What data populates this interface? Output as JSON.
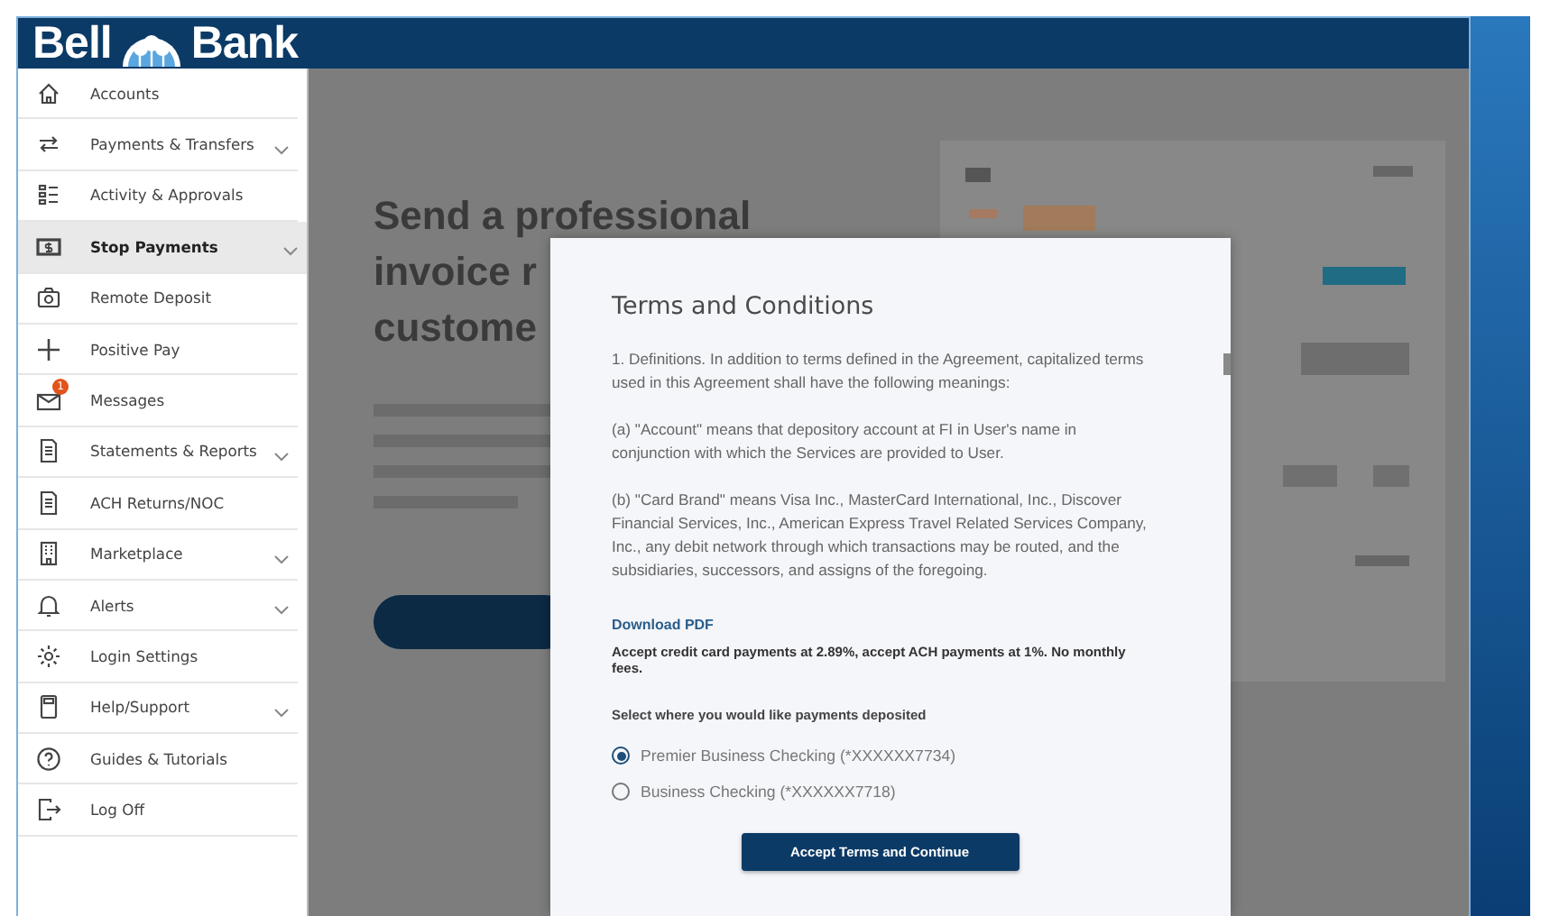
{
  "header": {
    "logo_left": "Bell",
    "logo_right": "Bank"
  },
  "sidebar": {
    "items": [
      {
        "label": "Accounts",
        "selected": false,
        "has_submenu": false
      },
      {
        "label": "Payments & Transfers",
        "selected": false,
        "has_submenu": true
      },
      {
        "label": "Activity & Approvals",
        "selected": false,
        "has_submenu": false
      },
      {
        "label": "Stop Payments",
        "selected": true,
        "has_submenu": true
      },
      {
        "label": "Remote Deposit",
        "selected": false,
        "has_submenu": false
      },
      {
        "label": "Positive Pay",
        "selected": false,
        "has_submenu": false
      },
      {
        "label": "Messages",
        "selected": false,
        "has_submenu": false,
        "badge": "1"
      },
      {
        "label": "Statements & Reports",
        "selected": false,
        "has_submenu": true
      },
      {
        "label": "ACH Returns/NOC",
        "selected": false,
        "has_submenu": false
      },
      {
        "label": "Marketplace",
        "selected": false,
        "has_submenu": true
      },
      {
        "label": "Alerts",
        "selected": false,
        "has_submenu": true
      },
      {
        "label": "Login Settings",
        "selected": false,
        "has_submenu": false
      },
      {
        "label": "Help/Support",
        "selected": false,
        "has_submenu": true
      },
      {
        "label": "Guides & Tutorials",
        "selected": false,
        "has_submenu": false
      },
      {
        "label": "Log Off",
        "selected": false,
        "has_submenu": false
      }
    ]
  },
  "background": {
    "heading_lines": [
      "Send a professional",
      "invoice r",
      "custome"
    ]
  },
  "modal": {
    "title": "Terms and Conditions",
    "paragraphs": [
      "1. Definitions. In addition to terms defined in the Agreement, capitalized terms used in this Agreement shall have the following meanings:",
      "(a) \"Account\" means that depository account at FI in User's name in conjunction with which the Services are provided to User.",
      "(b) \"Card Brand\" means Visa Inc., MasterCard International, Inc., Discover Financial Services, Inc., American Express Travel Related Services Company, Inc., any debit network through which transactions may be routed, and the subsidiaries, successors, and assigns of the foregoing."
    ],
    "download_link": "Download PDF",
    "fees_note": "Accept credit card payments at 2.89%, accept ACH payments at 1%. No monthly fees.",
    "deposit_prompt": "Select where you would like payments deposited",
    "accounts": [
      {
        "label": "Premier Business Checking (*XXXXXX7734)",
        "selected": true
      },
      {
        "label": "Business Checking (*XXXXXX7718)",
        "selected": false
      }
    ],
    "button": "Accept Terms and Continue"
  }
}
